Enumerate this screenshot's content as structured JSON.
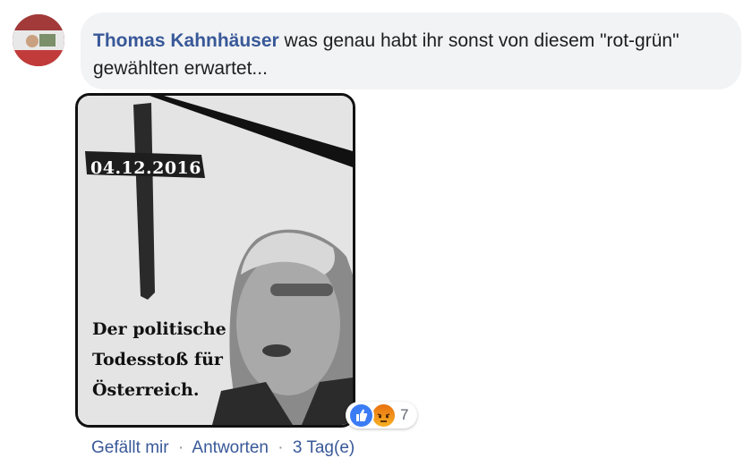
{
  "comment": {
    "author": "Thomas Kahnhäuser",
    "text": " was genau habt ihr sonst von diesem \"rot-grün\" gewählten erwartet..."
  },
  "meme": {
    "date": "04.12.2016",
    "caption_lines": [
      "Der politische",
      "Todesstoß für",
      "Österreich."
    ]
  },
  "reactions": {
    "icons": [
      "like-icon",
      "angry-icon"
    ],
    "count": "7"
  },
  "actions": {
    "like": "Gefällt mir",
    "reply": "Antworten",
    "time": "3 Tag(e)",
    "separator": "·"
  }
}
